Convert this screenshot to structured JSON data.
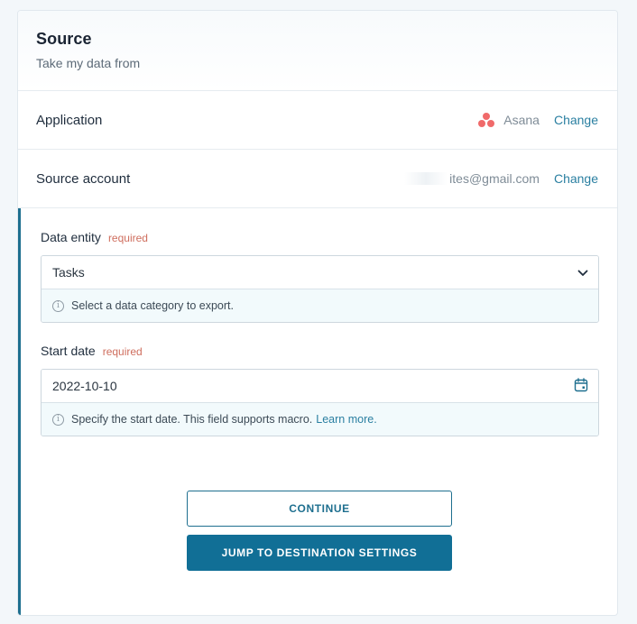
{
  "header": {
    "title": "Source",
    "subtitle": "Take my data from"
  },
  "application": {
    "label": "Application",
    "value": "Asana",
    "icon": "asana-icon",
    "change_label": "Change"
  },
  "source_account": {
    "label": "Source account",
    "value": "ites@gmail.com",
    "change_label": "Change"
  },
  "data_entity": {
    "label": "Data entity",
    "required_label": "required",
    "value": "Tasks",
    "hint": "Select a data category to export."
  },
  "start_date": {
    "label": "Start date",
    "required_label": "required",
    "value": "2022-10-10",
    "hint": "Specify the start date. This field supports macro.",
    "hint_link": "Learn more."
  },
  "buttons": {
    "continue_label": "CONTINUE",
    "jump_label": "JUMP TO DESTINATION SETTINGS"
  },
  "colors": {
    "accent": "#116f96",
    "link": "#2a7fa1",
    "required": "#cf6e5e",
    "asana": "#f06a6a"
  }
}
